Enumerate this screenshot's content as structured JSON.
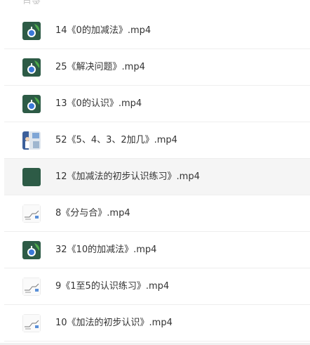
{
  "header_fragment": "目录",
  "files": [
    {
      "name": "14《0的加减法》.mp4",
      "thumb": "green-icon"
    },
    {
      "name": "25《解决问题》.mp4",
      "thumb": "green-icon"
    },
    {
      "name": "13《0的认识》.mp4",
      "thumb": "green-icon"
    },
    {
      "name": "52《5、4、3、2加几》.mp4",
      "thumb": "photo-thumb"
    },
    {
      "name": "12《加减法的初步认识练习》.mp4",
      "thumb": "dark-green-square",
      "selected": true
    },
    {
      "name": "8《分与合》.mp4",
      "thumb": "sketch-thumb"
    },
    {
      "name": "32《10的加减法》.mp4",
      "thumb": "green-icon"
    },
    {
      "name": "9《1至5的认识练习》.mp4",
      "thumb": "sketch-thumb"
    },
    {
      "name": "10《加法的初步认识》.mp4",
      "thumb": "sketch-thumb"
    }
  ],
  "colors": {
    "green": "#2d5b46",
    "accent_blue": "#3a78d8",
    "row_selected": "#f5f5f5"
  }
}
